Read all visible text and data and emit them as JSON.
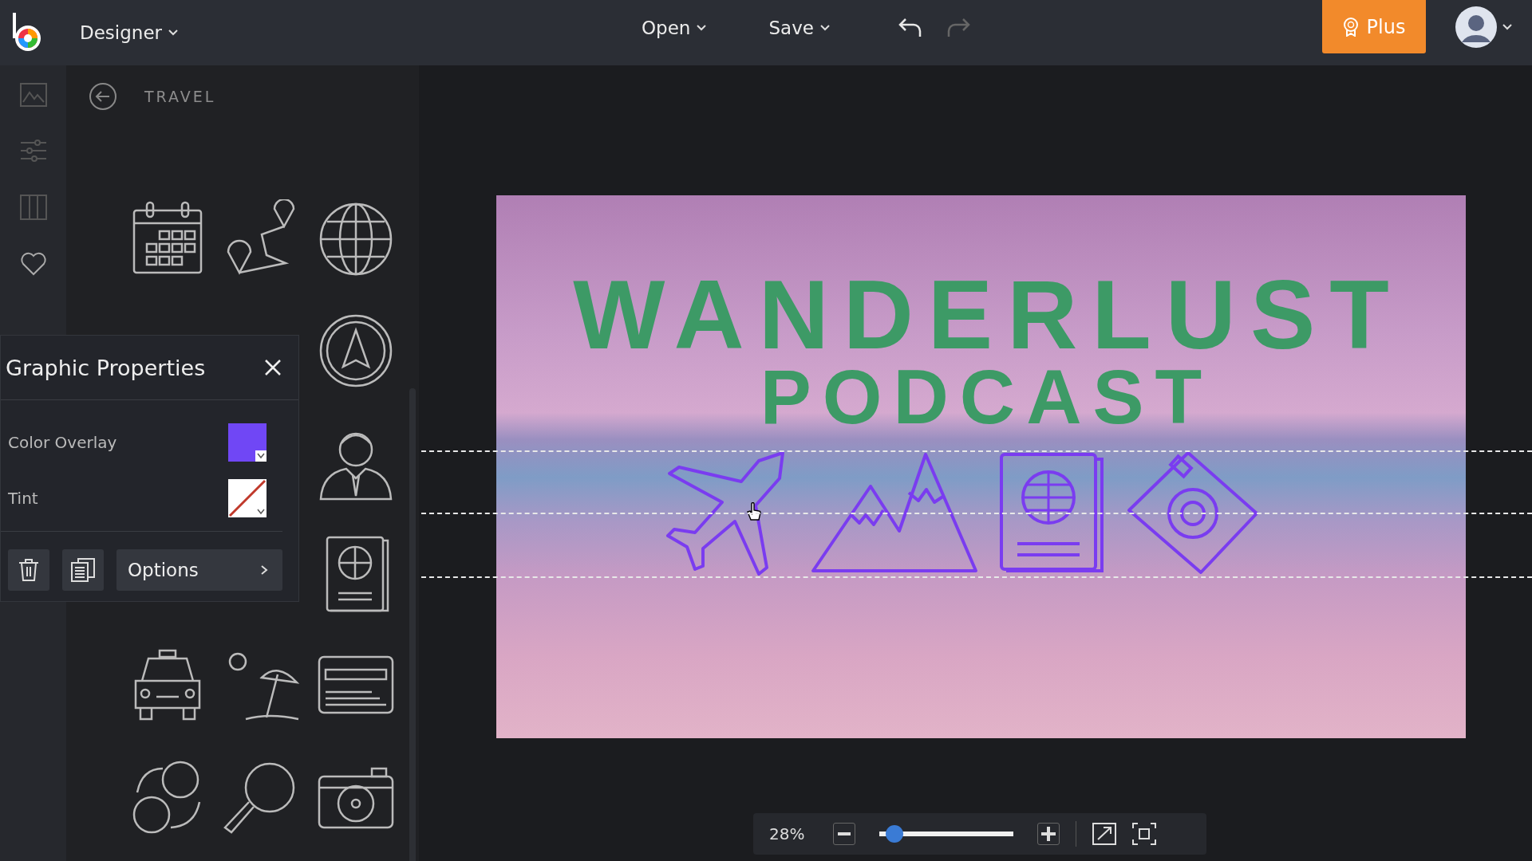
{
  "top_bar": {
    "mode_menu": "Designer",
    "menus": [
      "Open",
      "Save"
    ],
    "plus_button": "Plus"
  },
  "sidebar": {
    "section_title": "TRAVEL"
  },
  "properties_panel": {
    "title": "Graphic Properties",
    "rows": [
      {
        "label": "Color Overlay",
        "kind": "color",
        "color": "#7047f5"
      },
      {
        "label": "Tint",
        "kind": "none"
      }
    ],
    "options_button": "Options"
  },
  "canvas": {
    "title_text": "WANDERLUST",
    "subtitle_text": "PODCAST"
  },
  "zoom_bar": {
    "reading": "28%",
    "level": 0.1
  }
}
